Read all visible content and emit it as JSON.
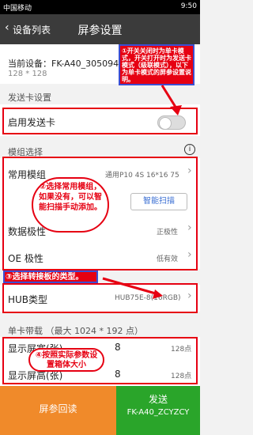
{
  "status": {
    "carrier": "中国移动",
    "time": "9:50"
  },
  "header": {
    "back_label": "设备列表",
    "title": "屏参设置"
  },
  "device": {
    "label": "当前设备：FK-A40_30509435",
    "resolution": "128 * 128"
  },
  "send_card": {
    "section_title": "发送卡设置",
    "toggle_label": "启用发送卡",
    "toggle_on": false
  },
  "module": {
    "section_title": "模组选择",
    "common_label": "常用模组",
    "common_value": "通用P10 4S 16*16 75",
    "scan_button": "智能扫描",
    "data_polarity_label": "数据极性",
    "data_polarity_value": "正极性",
    "oe_polarity_label": "OE 极性",
    "oe_polarity_value": "低有效"
  },
  "hub": {
    "label": "HUB类型",
    "value": "HUB75E-8(16RGB)"
  },
  "single_card": {
    "section_title": "单卡带载  （最大   1024 * 192   点）"
  },
  "display": {
    "width_label": "显示屏宽(张)",
    "width_value": "8",
    "width_points": "128点",
    "height_label": "显示屏高(张)",
    "height_value": "8",
    "height_points": "128点"
  },
  "footer": {
    "readback_button": "屏参回读",
    "send_button": "发送",
    "send_device": "FK-A40_ZCYZCY"
  },
  "annotations": {
    "a1": "①开关关闭时为单卡模式，开关打开时为发送卡模式（级联模式），以下为单卡模式的屏参设置说明。",
    "a2": "②选择常用模组，如果没有，可以智能扫描手动添加。",
    "a3": "③选择转接板的类型。",
    "a4": "④按照实际参数设置箱体大小"
  },
  "colors": {
    "annotation_red": "#e60012",
    "title_bar": "#3b3b3b",
    "readback": "#f08a2a",
    "send": "#2aa52a"
  }
}
